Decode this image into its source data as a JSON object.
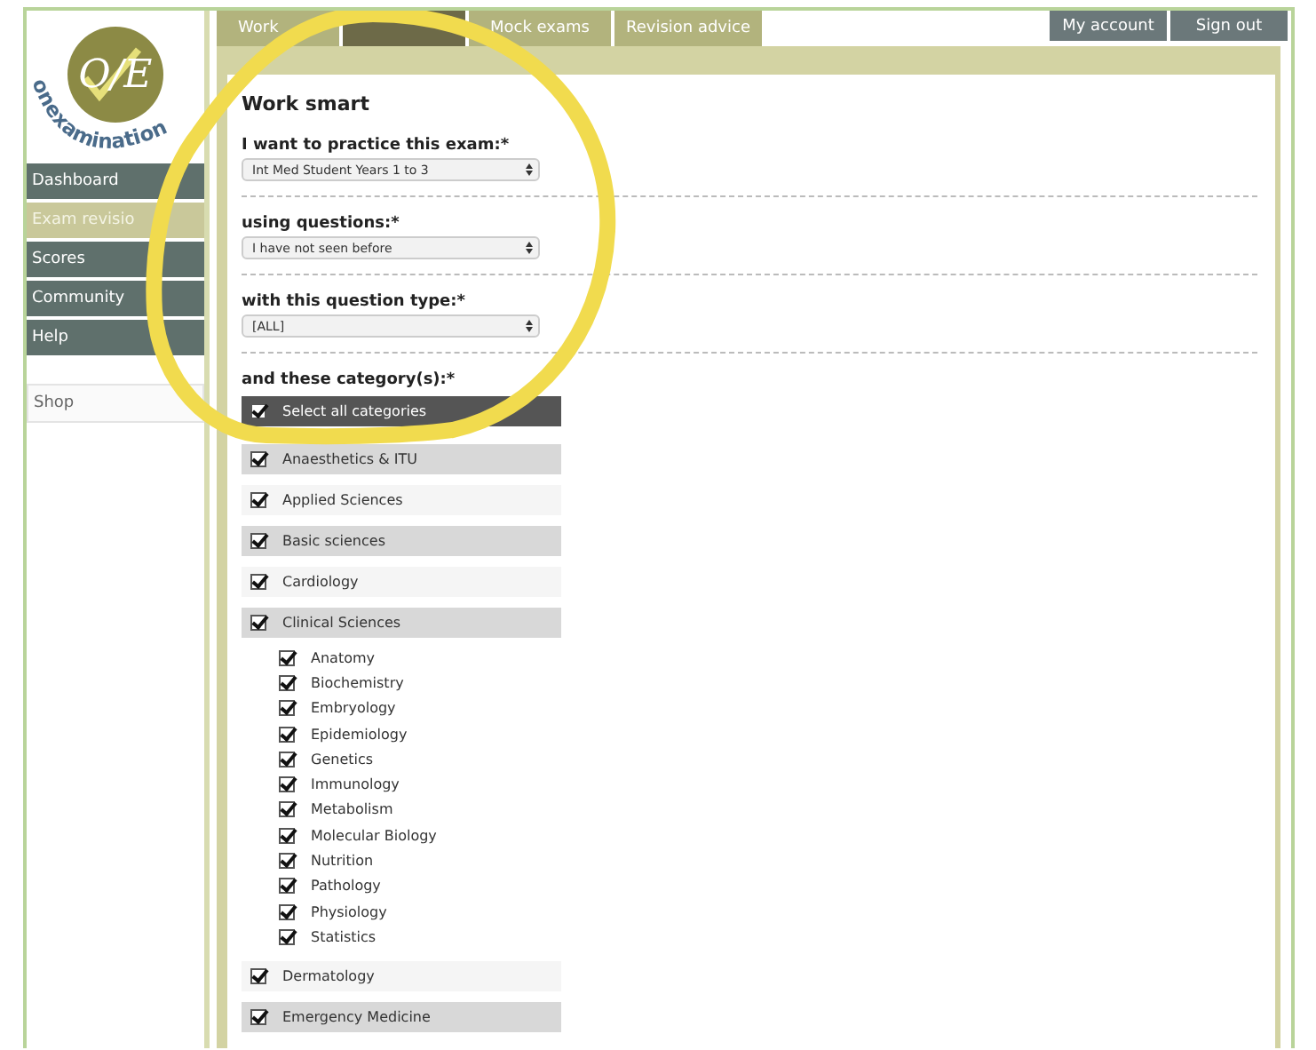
{
  "logo": {
    "monogram": "O/E",
    "wordmark": "onexamination"
  },
  "tabs": [
    {
      "label": "Work",
      "selected": false
    },
    {
      "selected": true
    },
    {
      "label": "Mock exams",
      "selected": false
    },
    {
      "label": "Revision advice",
      "selected": false
    }
  ],
  "account_buttons": [
    "My account",
    "Sign out"
  ],
  "sidebar": {
    "items": [
      {
        "label": "Dashboard",
        "selected": false
      },
      {
        "label": "Exam revisio",
        "selected": true
      },
      {
        "label": "Scores",
        "selected": false
      },
      {
        "label": "Community",
        "selected": false
      },
      {
        "label": "Help",
        "selected": false
      }
    ],
    "shop": "Shop"
  },
  "form": {
    "title": "Work smart",
    "fields": [
      {
        "label": "I want to practice this exam:*",
        "value": "Int Med Student Years 1 to 3"
      },
      {
        "label": "using questions:*",
        "value": "I have not seen before"
      },
      {
        "label": "with this question type:*",
        "value": "[ALL]"
      }
    ],
    "categories_label": "and these category(s):*",
    "select_all": {
      "label": "Select all categories",
      "checked": true
    },
    "categories": [
      {
        "label": "Anaesthetics & ITU",
        "checked": true
      },
      {
        "label": "Applied Sciences",
        "checked": true
      },
      {
        "label": "Basic sciences",
        "checked": true
      },
      {
        "label": "Cardiology",
        "checked": true
      },
      {
        "label": "Clinical Sciences",
        "checked": true,
        "children": [
          {
            "label": "Anatomy",
            "checked": true
          },
          {
            "label": "Biochemistry",
            "checked": true
          },
          {
            "label": "Embryology",
            "checked": true
          },
          {
            "label": "Epidemiology",
            "checked": true
          },
          {
            "label": "Genetics",
            "checked": true
          },
          {
            "label": "Immunology",
            "checked": true
          },
          {
            "label": "Metabolism",
            "checked": true
          },
          {
            "label": "Molecular Biology",
            "checked": true
          },
          {
            "label": "Nutrition",
            "checked": true
          },
          {
            "label": "Pathology",
            "checked": true
          },
          {
            "label": "Physiology",
            "checked": true
          },
          {
            "label": "Statistics",
            "checked": true
          }
        ]
      },
      {
        "label": "Dermatology",
        "checked": true
      },
      {
        "label": "Emergency Medicine",
        "checked": true
      }
    ]
  }
}
